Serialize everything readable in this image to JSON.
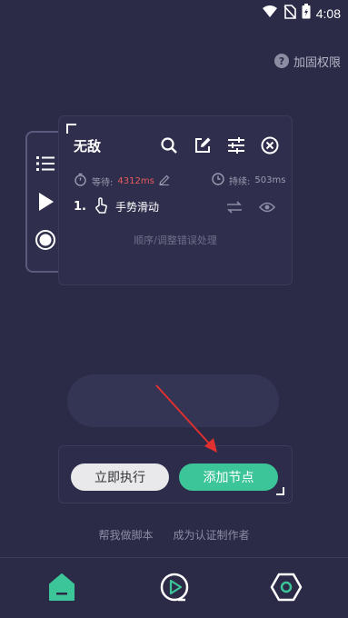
{
  "status_bar": {
    "time": "4:08"
  },
  "permission": {
    "label": "加固权限"
  },
  "side_panel": {
    "items": [
      "list-icon",
      "play-icon",
      "record-icon"
    ]
  },
  "card": {
    "title": "无敌",
    "wait_label": "等待:",
    "wait_value": "4312ms",
    "duration_label": "持续:",
    "duration_value": "503ms",
    "step_number": "1.",
    "step_label": "手势滑动",
    "hint": "顺序/调整错误处理"
  },
  "actions": {
    "execute": "立即执行",
    "add_node": "添加节点"
  },
  "links": {
    "help": "帮我做脚本",
    "certify": "成为认证制作者"
  },
  "colors": {
    "background": "#2b2b47",
    "accent": "#3cc598",
    "red": "#e85a5a"
  }
}
